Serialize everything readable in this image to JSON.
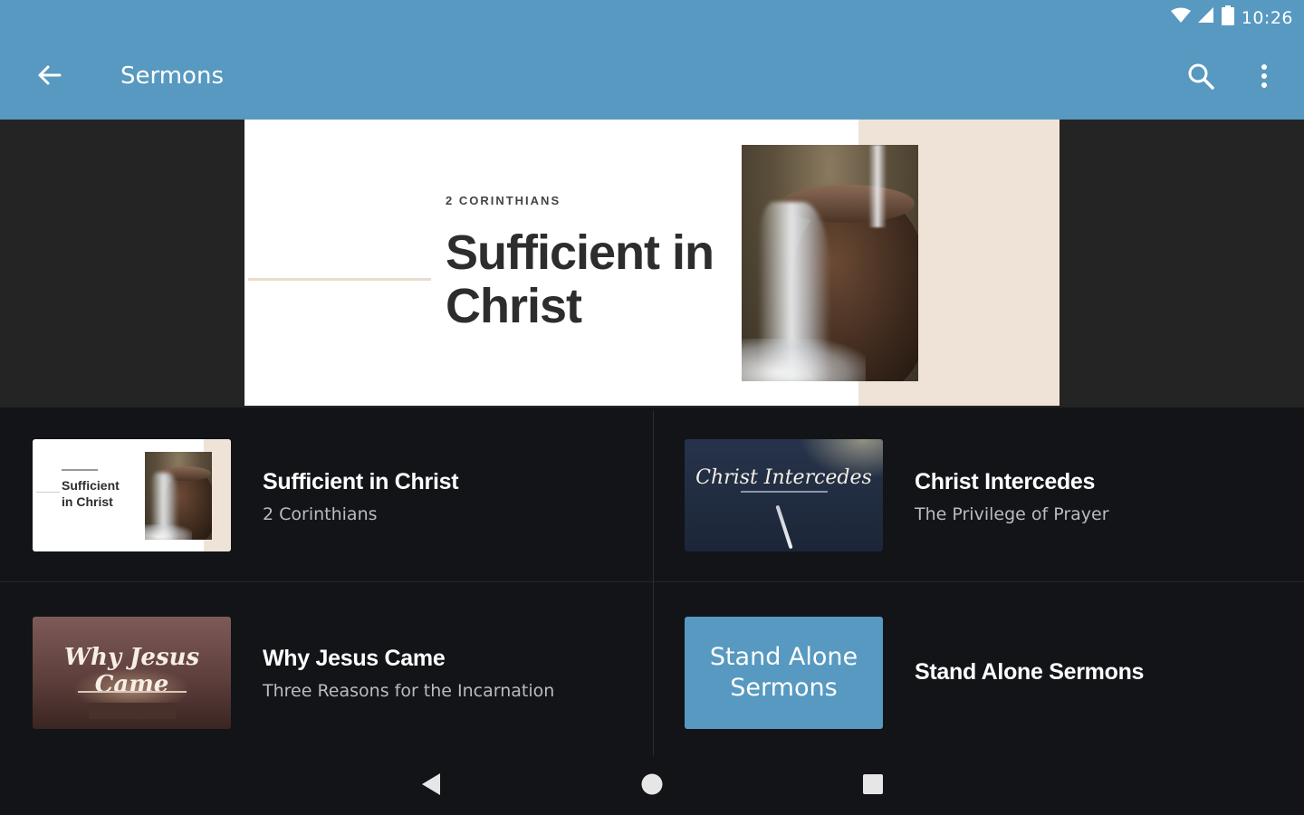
{
  "status_bar": {
    "time": "10:26",
    "icons": [
      "wifi-icon",
      "signal-icon",
      "battery-icon"
    ]
  },
  "app_bar": {
    "title": "Sermons",
    "actions": [
      "back-arrow-icon",
      "search-icon",
      "more-vert-icon"
    ]
  },
  "hero": {
    "kicker": "2 CORINTHIANS",
    "title": "Sufficient in Christ"
  },
  "series": [
    {
      "title": "Sufficient in Christ",
      "subtitle": "2 Corinthians",
      "thumb_text": "Sufficient in Christ"
    },
    {
      "title": "Christ Intercedes",
      "subtitle": "The Privilege of Prayer",
      "thumb_text": "Christ Intercedes"
    },
    {
      "title": "Why Jesus Came",
      "subtitle": "Three Reasons for the Incarnation",
      "thumb_text": "Why Jesus Came"
    },
    {
      "title": "Stand Alone Sermons",
      "subtitle": "",
      "thumb_text": "Stand Alone Sermons"
    }
  ],
  "nav_bar": {
    "buttons": [
      "back-triangle-icon",
      "home-circle-icon",
      "recents-square-icon"
    ]
  },
  "colors": {
    "accent": "#5799c0",
    "background": "#121418",
    "hero_background": "#242424",
    "hero_beige": "#efe3d8"
  }
}
